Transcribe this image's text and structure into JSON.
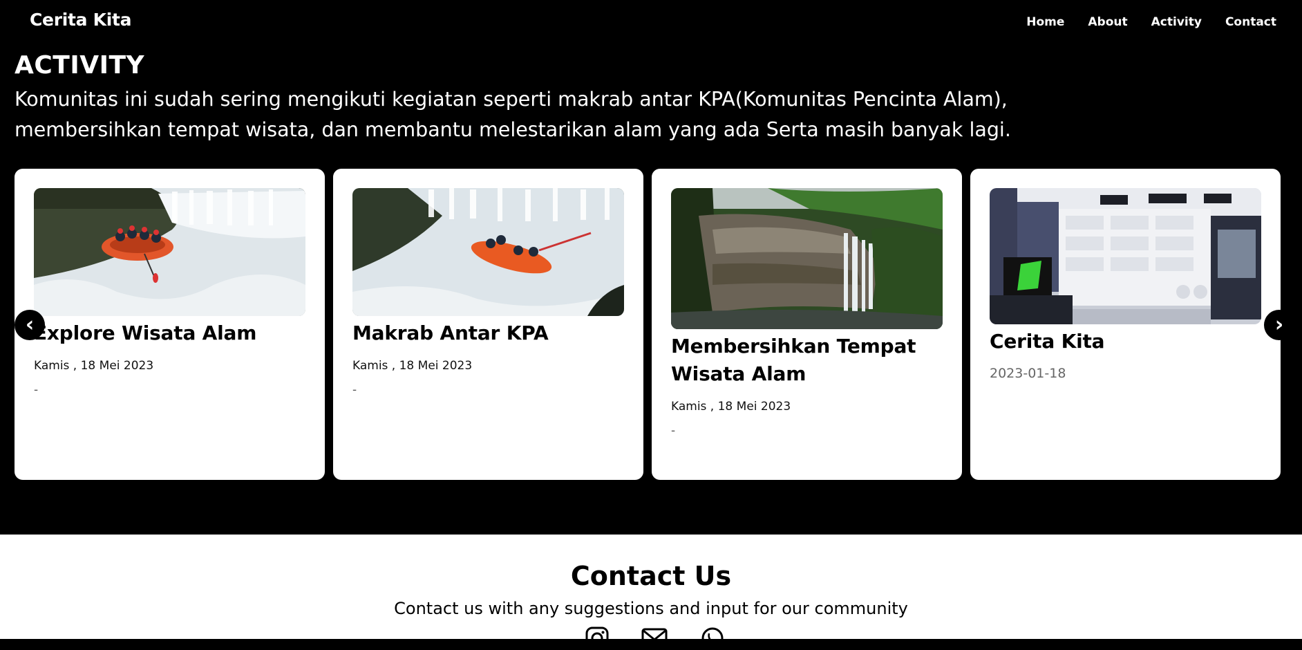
{
  "nav": {
    "brand": "Cerita Kita",
    "links": [
      "Home",
      "About",
      "Activity",
      "Contact"
    ]
  },
  "activity": {
    "title": "ACTIVITY",
    "description": "Komunitas ini sudah sering mengikuti kegiatan seperti makrab antar KPA(Komunitas Pencinta Alam), membersihkan tempat wisata, dan membantu melestarikan alam yang ada Serta masih banyak lagi.",
    "cards": [
      {
        "title": "Explore Wisata Alam",
        "date": "Kamis , 18 Mei 2023",
        "dash": "-",
        "image": "rafting-waterfall-photo"
      },
      {
        "title": "Makrab Antar KPA",
        "date": "Kamis , 18 Mei 2023",
        "dash": "-",
        "image": "rafting-rapids-photo"
      },
      {
        "title": "Membersihkan Tempat Wisata Alam",
        "date": "Kamis , 18 Mei 2023",
        "dash": "-",
        "image": "jungle-waterfall-photo"
      },
      {
        "title": "Cerita Kita",
        "date": "2023-01-18",
        "image": "electronics-store-photo"
      }
    ],
    "prev_arrow": "‹",
    "next_arrow": "›"
  },
  "contact": {
    "title": "Contact Us",
    "subtitle": "Contact us with any suggestions and input for our community",
    "icons": [
      "instagram-icon",
      "mail-icon",
      "whatsapp-icon"
    ]
  }
}
